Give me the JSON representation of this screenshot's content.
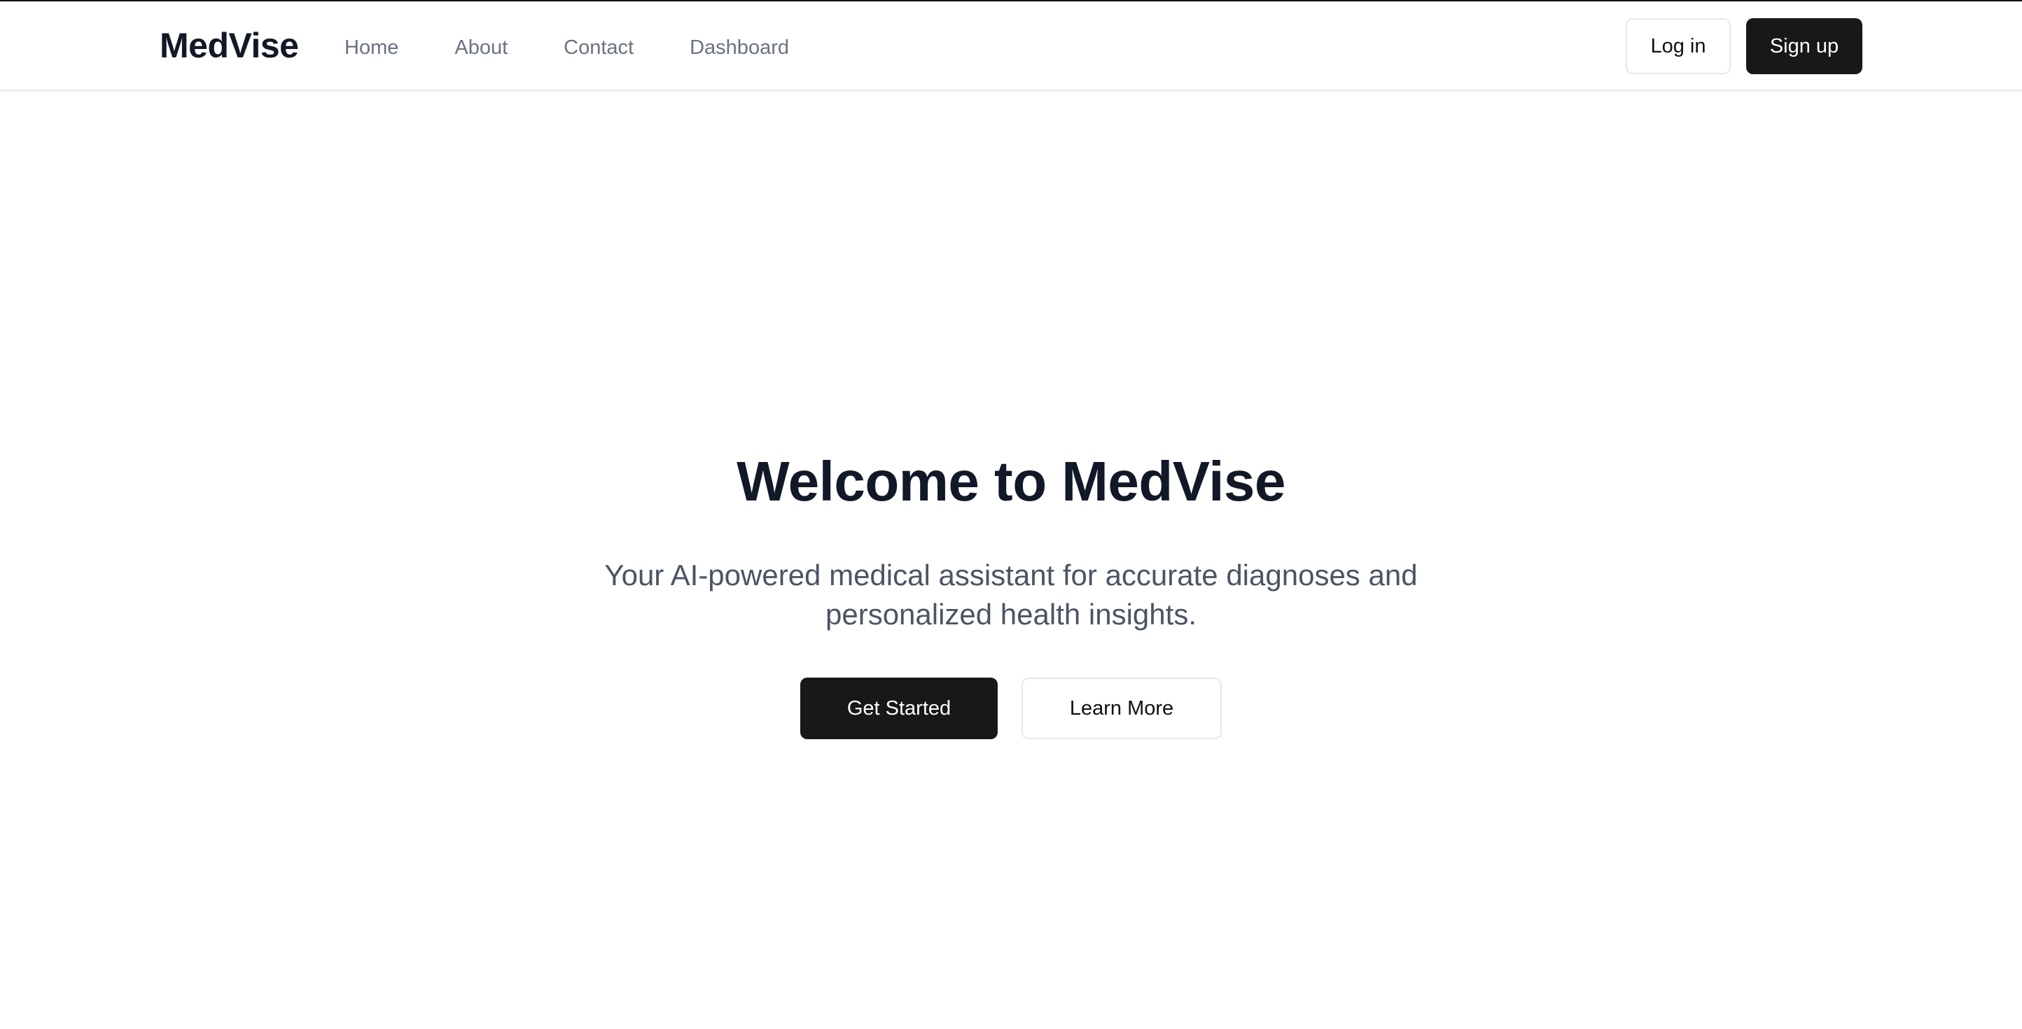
{
  "navbar": {
    "brand": "MedVise",
    "links": [
      {
        "label": "Home"
      },
      {
        "label": "About"
      },
      {
        "label": "Contact"
      },
      {
        "label": "Dashboard"
      }
    ],
    "login_label": "Log in",
    "signup_label": "Sign up"
  },
  "hero": {
    "title": "Welcome to MedVise",
    "subtitle": "Your AI-powered medical assistant for accurate diagnoses and personalized health insights.",
    "primary_label": "Get Started",
    "secondary_label": "Learn More"
  },
  "colors": {
    "primary_button": "#18181b",
    "heading_text": "#111827",
    "nav_text": "#6b7280",
    "subtitle_text": "#4b5563",
    "border": "#e5e7eb"
  }
}
